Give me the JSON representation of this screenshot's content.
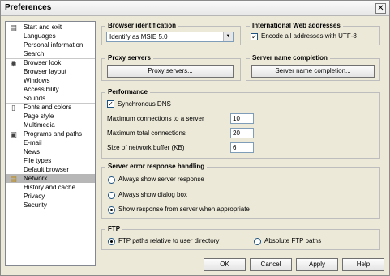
{
  "window": {
    "title": "Preferences",
    "close_symbol": "✕"
  },
  "nav": {
    "items": [
      {
        "label": "Start and exit",
        "icon": "document-icon"
      },
      {
        "label": "Languages"
      },
      {
        "label": "Personal information"
      },
      {
        "label": "Search"
      },
      {
        "label": "Browser look",
        "icon": "eye-icon"
      },
      {
        "label": "Browser layout"
      },
      {
        "label": "Windows"
      },
      {
        "label": "Accessibility"
      },
      {
        "label": "Sounds"
      },
      {
        "label": "Fonts and colors",
        "icon": "page-icon"
      },
      {
        "label": "Page style"
      },
      {
        "label": "Multimedia"
      },
      {
        "label": "Programs and paths",
        "icon": "disk-icon"
      },
      {
        "label": "E-mail"
      },
      {
        "label": "News"
      },
      {
        "label": "File types"
      },
      {
        "label": "Default browser"
      },
      {
        "label": "Network",
        "icon": "lock-icon",
        "selected": true
      },
      {
        "label": "History and cache"
      },
      {
        "label": "Privacy"
      },
      {
        "label": "Security"
      }
    ]
  },
  "browser_id": {
    "title": "Browser identification",
    "value": "Identify as MSIE 5.0"
  },
  "intl": {
    "title": "International Web addresses",
    "checkbox_label": "Encode all addresses with UTF-8",
    "checked": true
  },
  "proxy": {
    "title": "Proxy servers",
    "button": "Proxy servers..."
  },
  "server_name": {
    "title": "Server name completion",
    "button": "Server name completion..."
  },
  "performance": {
    "title": "Performance",
    "sync_dns": "Synchronous DNS",
    "sync_dns_checked": true,
    "fields": [
      {
        "label": "Maximum connections to a server",
        "value": "10"
      },
      {
        "label": "Maximum total connections",
        "value": "20"
      },
      {
        "label": "Size of network buffer (KB)",
        "value": "6"
      }
    ]
  },
  "server_error": {
    "title": "Server error response handling",
    "options": [
      {
        "label": "Always show server response",
        "selected": false
      },
      {
        "label": "Always show dialog box",
        "selected": false
      },
      {
        "label": "Show response from server when appropriate",
        "selected": true
      }
    ]
  },
  "ftp": {
    "title": "FTP",
    "options": [
      {
        "label": "FTP paths relative to user directory",
        "selected": true
      },
      {
        "label": "Absolute FTP paths",
        "selected": false
      }
    ]
  },
  "buttons": {
    "ok": "OK",
    "cancel": "Cancel",
    "apply": "Apply",
    "help": "Help"
  }
}
